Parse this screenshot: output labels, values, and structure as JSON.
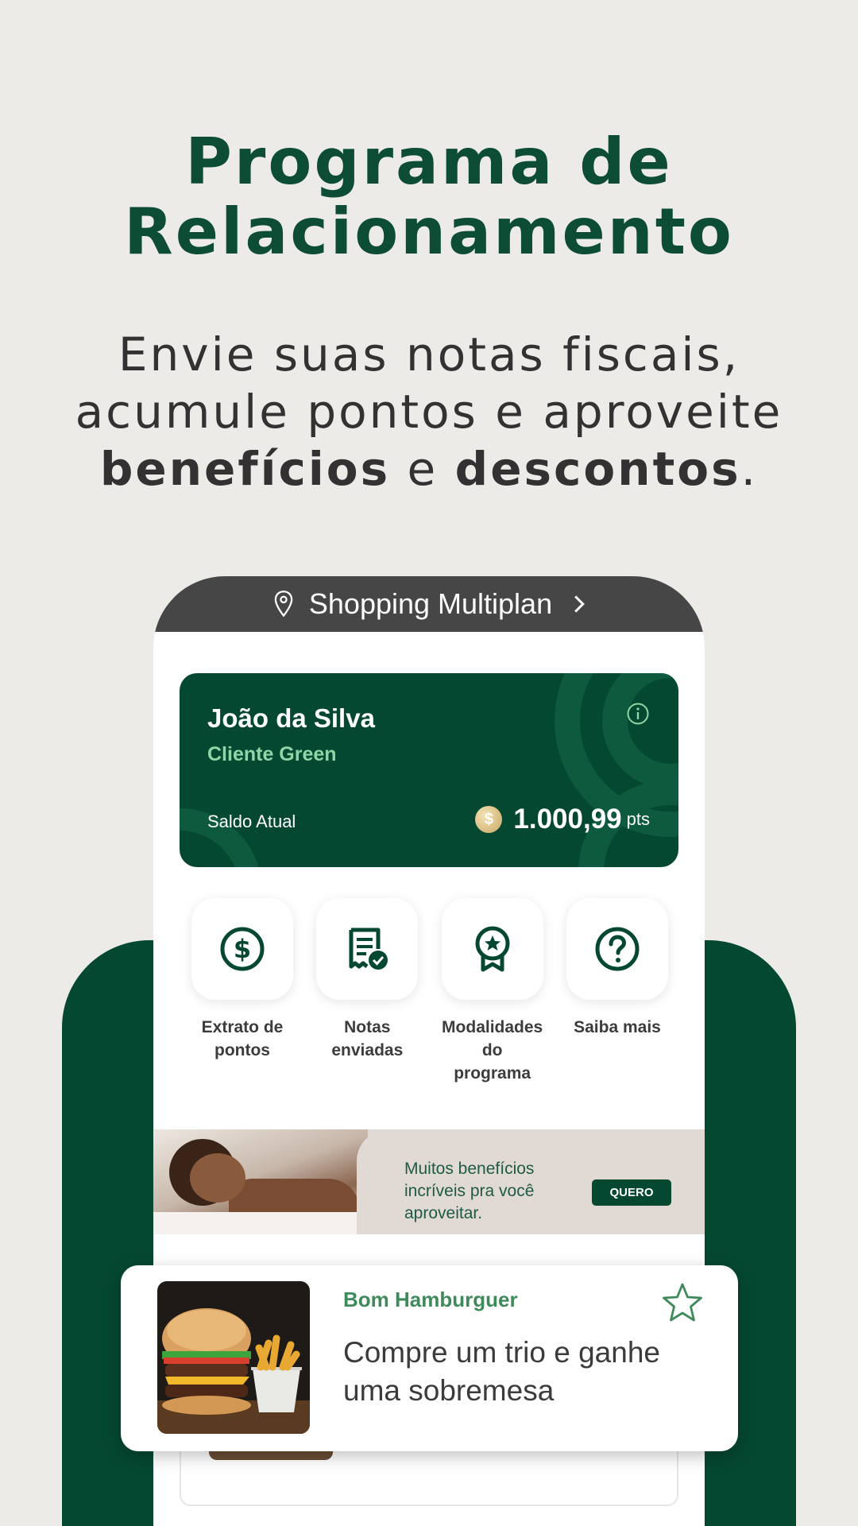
{
  "hero": {
    "title_line1": "Programa de",
    "title_line2": "Relacionamento",
    "sub_line1": "Envie suas notas fiscais,",
    "sub_line2": "acumule pontos e aproveite",
    "sub_bold1": "benefícios",
    "sub_mid": " e ",
    "sub_bold2": "descontos",
    "sub_end": "."
  },
  "header": {
    "mall_name": "Shopping Multiplan",
    "pin_icon": "map-pin-icon",
    "chevron_icon": "chevron-right-icon"
  },
  "card": {
    "name": "João da Silva",
    "tier": "Cliente Green",
    "balance_label": "Saldo Atual",
    "coin_symbol": "$",
    "balance_value": "1.000,99",
    "balance_unit": "pts"
  },
  "actions": [
    {
      "label_line1": "Extrato de",
      "label_line2": "pontos",
      "icon": "dollar-circle-icon"
    },
    {
      "label_line1": "Notas",
      "label_line2": "enviadas",
      "icon": "receipt-check-icon"
    },
    {
      "label_line1": "Modalidades",
      "label_line2": "do programa",
      "icon": "award-badge-icon"
    },
    {
      "label_line1": "Saiba mais",
      "label_line2": "",
      "icon": "help-circle-icon"
    }
  ],
  "promo": {
    "text": "Muitos benefícios incríveis pra você aproveitar.",
    "button": "QUERO"
  },
  "offer": {
    "store": "Bom Hamburguer",
    "title": "Compre um trio e ganhe uma sobremesa",
    "favorite_icon": "star-icon"
  },
  "colors": {
    "brand_green": "#054832",
    "accent_green": "#8ed6a6",
    "background": "#ecebe8",
    "header_gray": "#464646"
  }
}
